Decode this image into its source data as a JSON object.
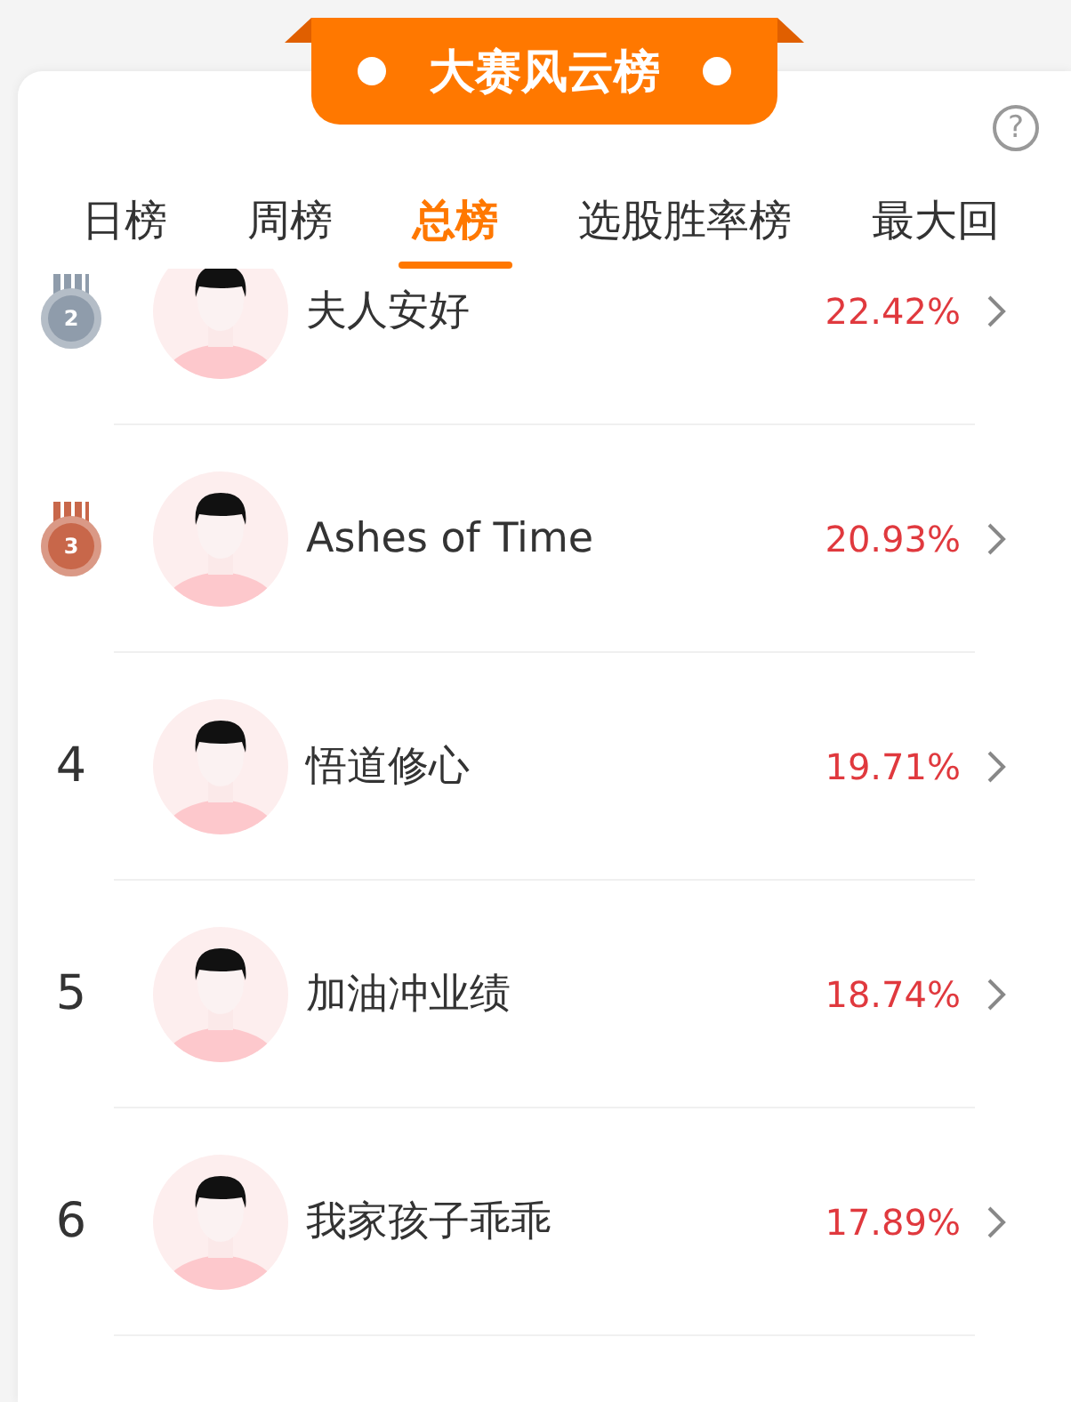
{
  "banner": {
    "title": "大赛风云榜"
  },
  "help": {
    "label": "?"
  },
  "tabs": [
    {
      "label": "日榜",
      "selected": false
    },
    {
      "label": "周榜",
      "selected": false
    },
    {
      "label": "总榜",
      "selected": true
    },
    {
      "label": "选股胜率榜",
      "selected": false
    },
    {
      "label": "最大回",
      "selected": false
    }
  ],
  "rows": [
    {
      "rank": {
        "kind": "medal",
        "text": "2",
        "color": "#8f9cab"
      },
      "name": "夫人安好",
      "rate": "22.42%"
    },
    {
      "rank": {
        "kind": "medal",
        "text": "3",
        "color": "#c8674a"
      },
      "name": "Ashes of Time",
      "rate": "20.93%"
    },
    {
      "rank": {
        "kind": "number",
        "text": "4"
      },
      "name": "悟道修心",
      "rate": "19.71%"
    },
    {
      "rank": {
        "kind": "number",
        "text": "5"
      },
      "name": "加油冲业绩",
      "rate": "18.74%"
    },
    {
      "rank": {
        "kind": "number",
        "text": "6"
      },
      "name": "我家孩子乖乖",
      "rate": "17.89%"
    }
  ]
}
